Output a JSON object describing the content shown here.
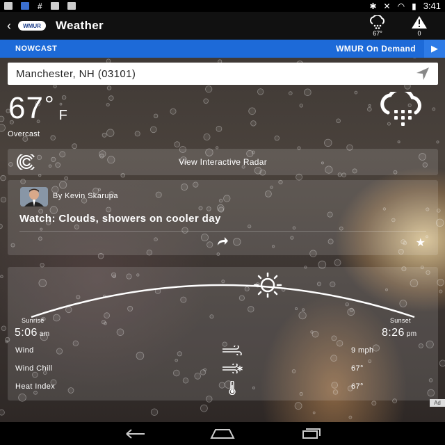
{
  "status_bar": {
    "time": "3:41"
  },
  "app_bar": {
    "logo_text": "WMUR",
    "title": "Weather",
    "temp_button_value": "67°",
    "alerts_count": "0"
  },
  "nowcast_bar": {
    "left_label": "NOWCAST",
    "right_label": "WMUR On Demand"
  },
  "location": {
    "value": "Manchester, NH (03101)"
  },
  "current": {
    "temp": "67",
    "degree": "°",
    "unit": "F",
    "condition": "Overcast"
  },
  "radar": {
    "label": "View Interactive Radar"
  },
  "story": {
    "author": "By Kevin Skarupa",
    "headline": "Watch: Clouds, showers on cooler day"
  },
  "sun": {
    "sunrise_label": "Sunrise",
    "sunrise_time": "5:06",
    "sunrise_period": "am",
    "sunset_label": "Sunset",
    "sunset_time": "8:26",
    "sunset_period": "pm"
  },
  "details": [
    {
      "label": "Wind",
      "value": "9 mph",
      "icon": "wind-icon"
    },
    {
      "label": "Wind Chill",
      "value": "67°",
      "icon": "wind-chill-icon"
    },
    {
      "label": "Heat Index",
      "value": "67°",
      "icon": "thermometer-icon"
    }
  ],
  "ad_label": "Ad",
  "colors": {
    "nowcast_bar": "#1d6ad8",
    "app_bar": "#111111"
  }
}
